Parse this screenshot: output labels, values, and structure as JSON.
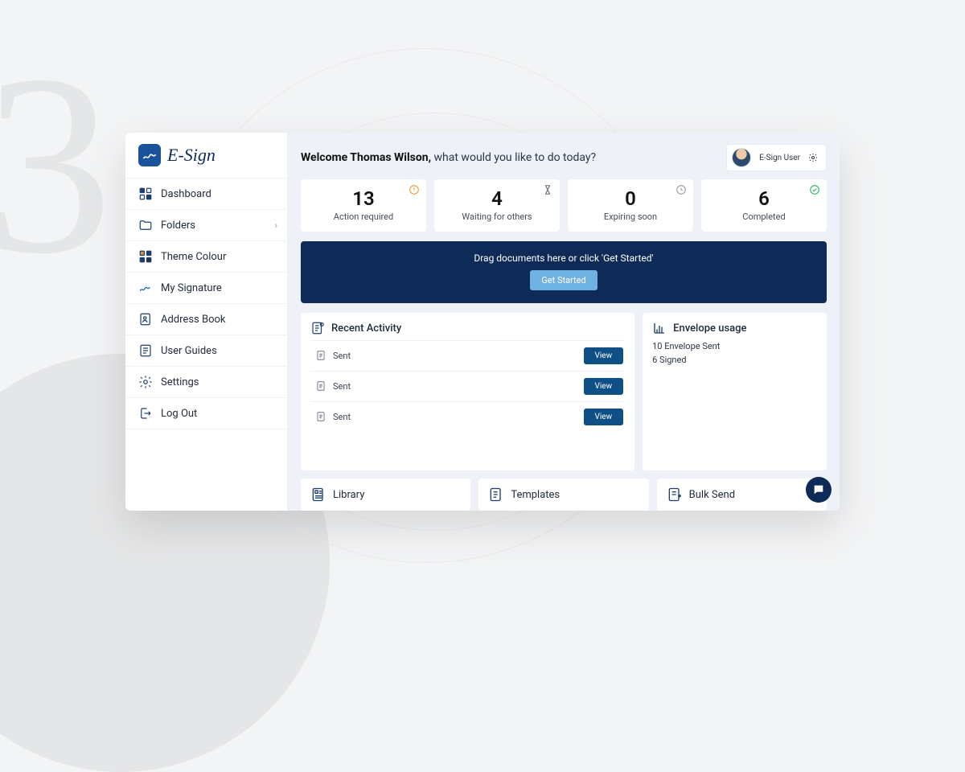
{
  "brand": {
    "name": "E-Sign"
  },
  "sidebar": {
    "items": [
      {
        "label": "Dashboard",
        "icon": "dashboard-icon",
        "expandable": false
      },
      {
        "label": "Folders",
        "icon": "folder-icon",
        "expandable": true
      },
      {
        "label": "Theme Colour",
        "icon": "palette-icon",
        "expandable": false
      },
      {
        "label": "My Signature",
        "icon": "signature-icon",
        "expandable": false
      },
      {
        "label": "Address Book",
        "icon": "addressbook-icon",
        "expandable": false
      },
      {
        "label": "User Guides",
        "icon": "guides-icon",
        "expandable": false
      },
      {
        "label": "Settings",
        "icon": "settings-icon",
        "expandable": false
      },
      {
        "label": "Log Out",
        "icon": "logout-icon",
        "expandable": false
      }
    ]
  },
  "header": {
    "welcome_bold": "Welcome Thomas Wilson,",
    "welcome_rest": " what would you like to do today?",
    "user_label": "E-Sign User"
  },
  "stats": [
    {
      "value": "13",
      "label": "Action required",
      "icon": "alert-icon",
      "icon_color": "#e8a13a"
    },
    {
      "value": "4",
      "label": "Waiting for others",
      "icon": "hourglass-icon",
      "icon_color": "#5a6572"
    },
    {
      "value": "0",
      "label": "Expiring soon",
      "icon": "clock-icon",
      "icon_color": "#9aa2ad"
    },
    {
      "value": "6",
      "label": "Completed",
      "icon": "check-icon",
      "icon_color": "#3bb56b"
    }
  ],
  "dropzone": {
    "text": "Drag documents here or click 'Get Started'",
    "button": "Get Started"
  },
  "recent_activity": {
    "title": "Recent Activity",
    "view_label": "View",
    "items": [
      {
        "status": "Sent"
      },
      {
        "status": "Sent"
      },
      {
        "status": "Sent"
      }
    ]
  },
  "envelope_usage": {
    "title": "Envelope usage",
    "line1": "10 Envelope Sent",
    "line2": "6 Signed"
  },
  "bottom_cards": [
    {
      "label": "Library",
      "icon": "library-icon"
    },
    {
      "label": "Templates",
      "icon": "templates-icon"
    },
    {
      "label": "Bulk Send",
      "icon": "bulksend-icon"
    }
  ],
  "bg_glyph": "3"
}
